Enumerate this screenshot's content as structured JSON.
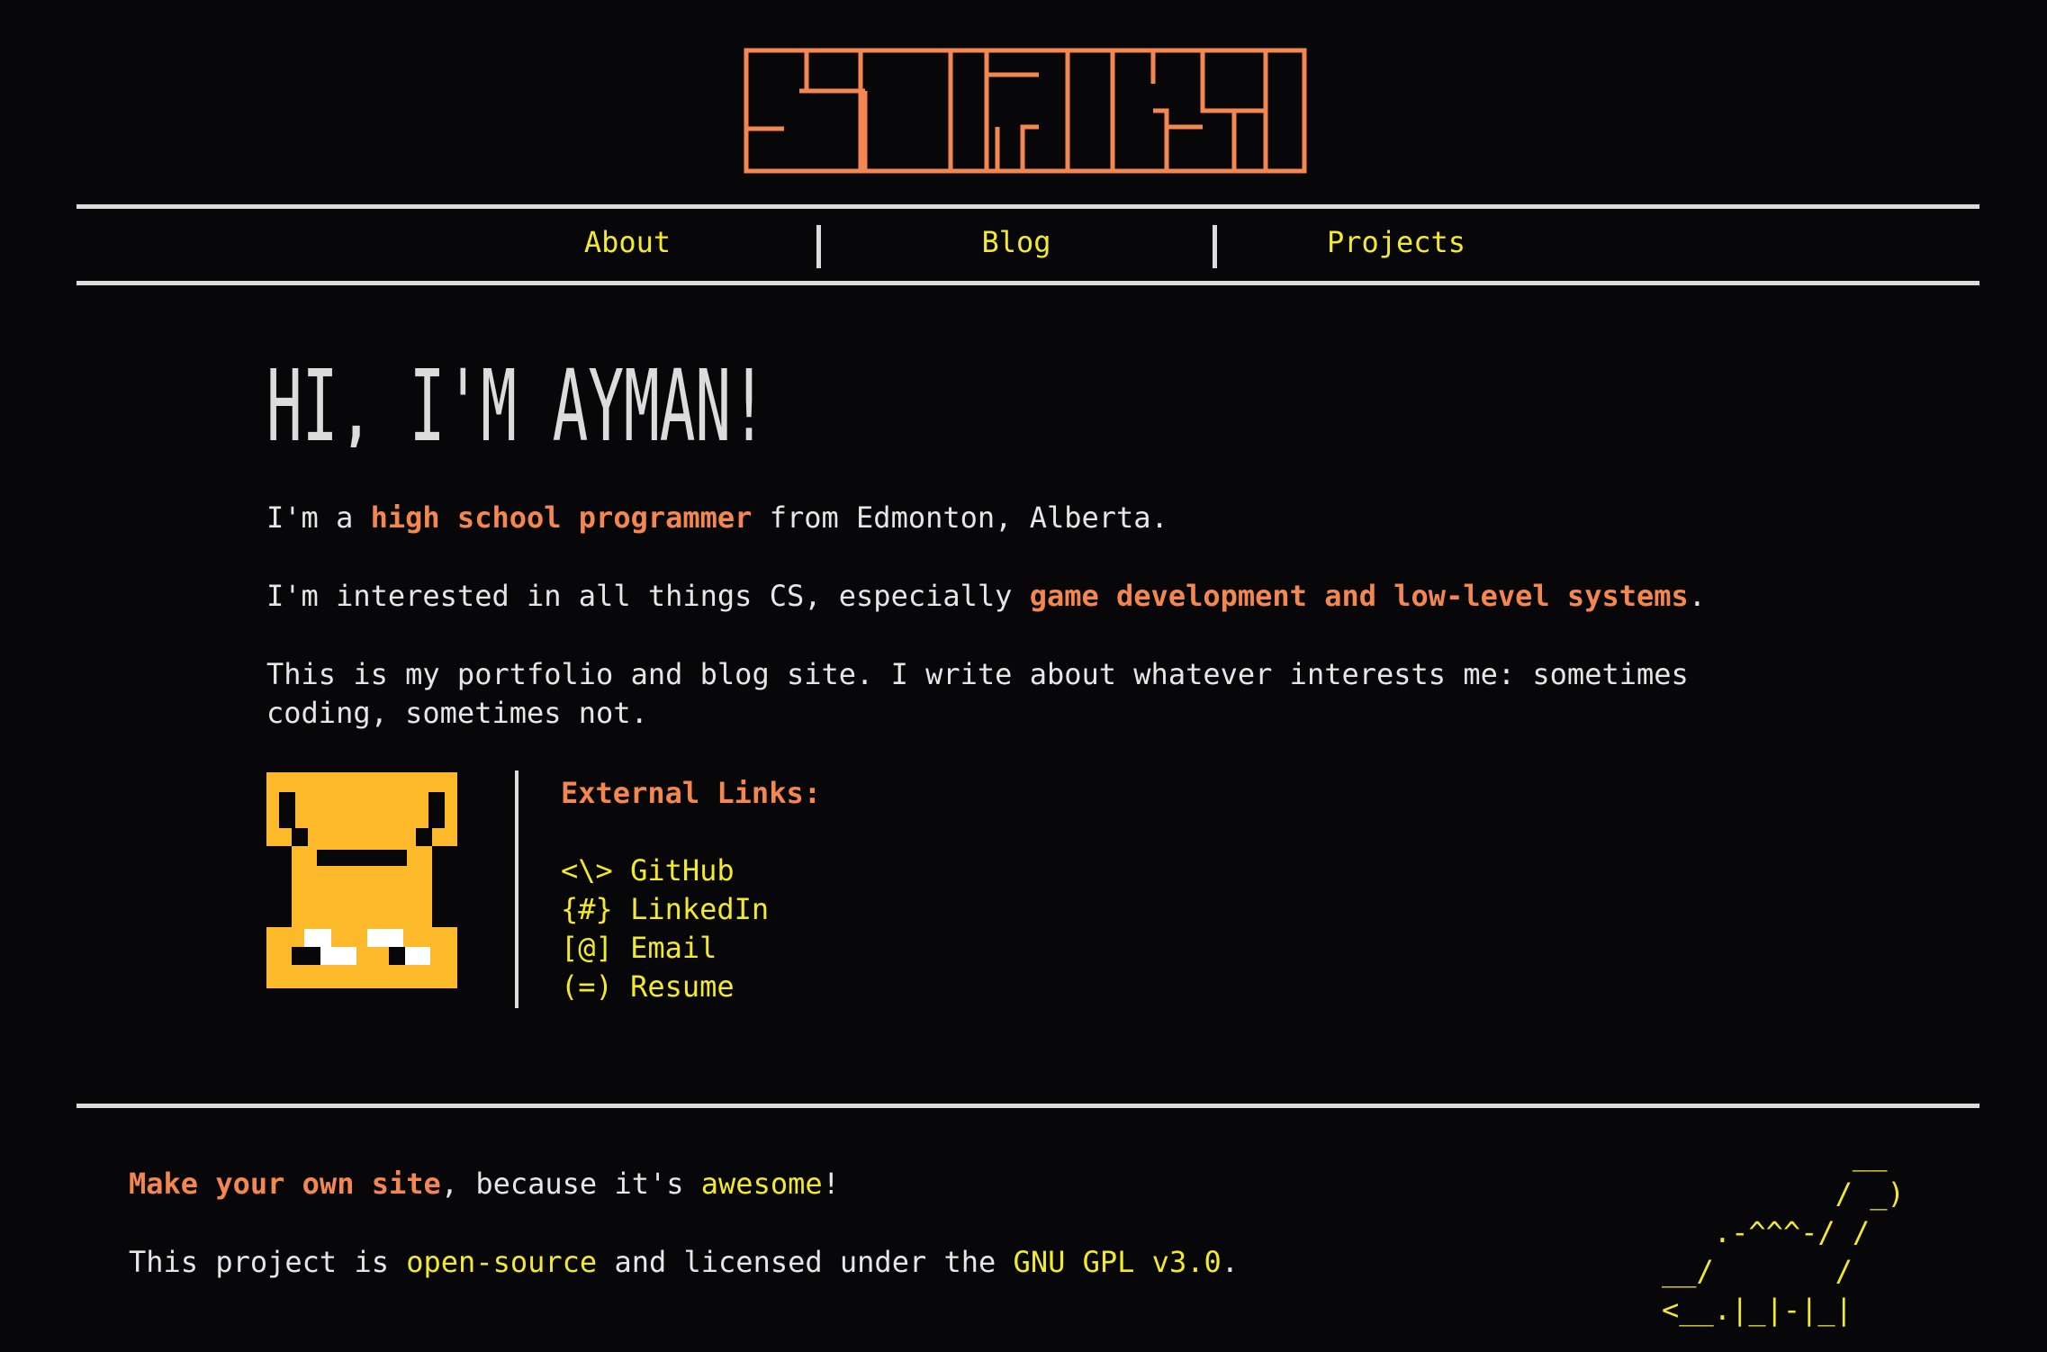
{
  "header": {
    "logo_text": "SUGOI",
    "logo_color": "#f4874f"
  },
  "nav": {
    "items": [
      {
        "label": "About"
      },
      {
        "label": "Blog"
      },
      {
        "label": "Projects"
      }
    ],
    "link_color": "#f2ea2a"
  },
  "main": {
    "heading": "HI, I'M AYMAN!",
    "intro": {
      "pre": "I'm a ",
      "highlight": "high school programmer",
      "post": " from Edmonton, Alberta."
    },
    "interests": {
      "pre": "I'm interested in all things CS, especially ",
      "highlight": "game development and low-level systems",
      "post": "."
    },
    "about_line1": "This is my portfolio and blog site. I write about whatever interests me: sometimes",
    "about_line2": "coding, sometimes not.",
    "avatar_icon": "pixel-creature-avatar",
    "external_links_title": "External Links:",
    "external_links": [
      {
        "prefix": "<\\>",
        "label": "GitHub"
      },
      {
        "prefix": "{#}",
        "label": "LinkedIn"
      },
      {
        "prefix": "[@]",
        "label": "Email"
      },
      {
        "prefix": "(=)",
        "label": "Resume"
      }
    ]
  },
  "footer": {
    "line1": {
      "link1": "Make your own site",
      "mid": ", because it's ",
      "link2": "awesome",
      "post": "!"
    },
    "line2": {
      "pre": "This project is ",
      "link1": "open-source",
      "mid": " and licensed under the ",
      "link2": "GNU GPL v3.0",
      "post": "."
    },
    "ascii_art": "           __\n          / _)\n   .-^^^-/ /\n__/       /\n<__.|_|-|_|"
  },
  "colors": {
    "background": "#07070a",
    "accent_orange": "#f4874f",
    "accent_yellow": "#f2ea2a",
    "text": "#e6e6e6",
    "avatar_yellow": "#fcba2b"
  }
}
